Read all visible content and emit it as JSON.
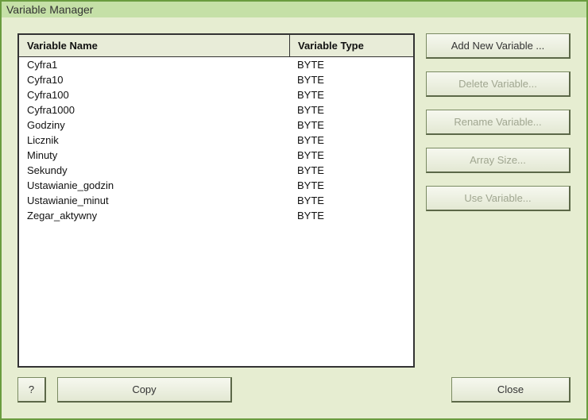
{
  "window": {
    "title": "Variable Manager"
  },
  "table": {
    "header": {
      "name": "Variable Name",
      "type": "Variable Type"
    },
    "rows": [
      {
        "name": "Cyfra1",
        "type": "BYTE"
      },
      {
        "name": "Cyfra10",
        "type": "BYTE"
      },
      {
        "name": "Cyfra100",
        "type": "BYTE"
      },
      {
        "name": "Cyfra1000",
        "type": "BYTE"
      },
      {
        "name": "Godziny",
        "type": "BYTE"
      },
      {
        "name": "Licznik",
        "type": "BYTE"
      },
      {
        "name": "Minuty",
        "type": "BYTE"
      },
      {
        "name": "Sekundy",
        "type": "BYTE"
      },
      {
        "name": "Ustawianie_godzin",
        "type": "BYTE"
      },
      {
        "name": "Ustawianie_minut",
        "type": "BYTE"
      },
      {
        "name": "Zegar_aktywny",
        "type": "BYTE"
      }
    ]
  },
  "buttons": {
    "add": "Add New Variable ...",
    "delete": "Delete Variable...",
    "rename": "Rename Variable...",
    "array": "Array Size...",
    "use": "Use Variable...",
    "help": "?",
    "copy": "Copy",
    "close": "Close"
  }
}
